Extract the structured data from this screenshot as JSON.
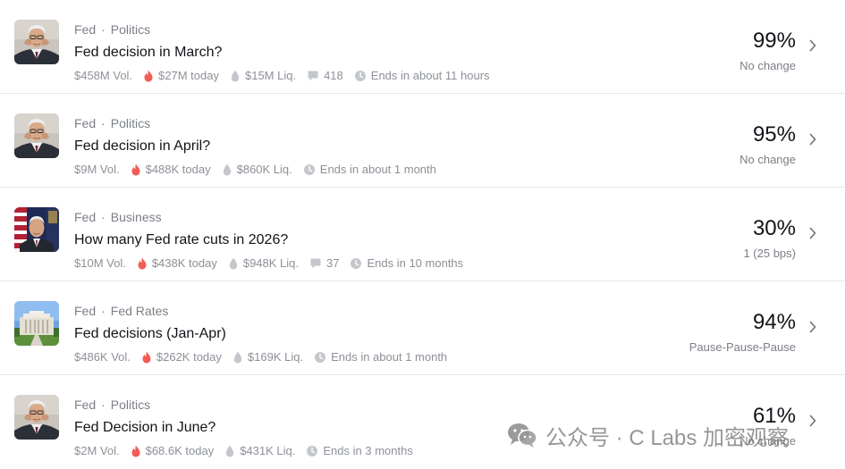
{
  "markets": [
    {
      "category_1": "Fed",
      "separator": "·",
      "category_2": "Politics",
      "title": "Fed decision in March?",
      "volume": "$458M Vol.",
      "today": "$27M today",
      "liquidity": "$15M Liq.",
      "comments": "418",
      "ends": "Ends in about 11 hours",
      "percent": "99%",
      "outcome": "No change",
      "image_icon": "powell-portrait-icon"
    },
    {
      "category_1": "Fed",
      "separator": "·",
      "category_2": "Politics",
      "title": "Fed decision in April?",
      "volume": "$9M Vol.",
      "today": "$488K today",
      "liquidity": "$860K Liq.",
      "ends": "Ends in about 1 month",
      "percent": "95%",
      "outcome": "No change",
      "image_icon": "powell-portrait-icon"
    },
    {
      "category_1": "Fed",
      "separator": "·",
      "category_2": "Business",
      "title": "How many Fed rate cuts in 2026?",
      "volume": "$10M Vol.",
      "today": "$438K today",
      "liquidity": "$948K Liq.",
      "comments": "37",
      "ends": "Ends in 10 months",
      "percent": "30%",
      "outcome": "1 (25 bps)",
      "image_icon": "powell-flag-portrait-icon"
    },
    {
      "category_1": "Fed",
      "separator": "·",
      "category_2": "Fed Rates",
      "title": "Fed decisions (Jan-Apr)",
      "volume": "$486K Vol.",
      "today": "$262K today",
      "liquidity": "$169K Liq.",
      "ends": "Ends in about 1 month",
      "percent": "94%",
      "outcome": "Pause-Pause-Pause",
      "image_icon": "federal-reserve-building-icon"
    },
    {
      "category_1": "Fed",
      "separator": "·",
      "category_2": "Politics",
      "title": "Fed Decision in June?",
      "volume": "$2M Vol.",
      "today": "$68.6K today",
      "liquidity": "$431K Liq.",
      "ends": "Ends in 3 months",
      "percent": "61%",
      "outcome": "No change",
      "image_icon": "powell-portrait-icon"
    }
  ],
  "watermark": {
    "text": "公众号 · C Labs 加密观察",
    "icon": "wechat-icon"
  },
  "colors": {
    "fire": "#f25c54",
    "meta_text": "#8c9097",
    "divider": "#e6e7ea"
  }
}
